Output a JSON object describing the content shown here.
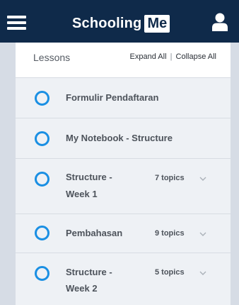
{
  "header": {
    "logo_text": "Schooling",
    "logo_box_text": "Me"
  },
  "panel": {
    "title": "Lessons",
    "expand_all": "Expand All",
    "separator": "|",
    "collapse_all": "Collapse All"
  },
  "lessons": [
    {
      "title_line1": "Formulir Pendaftaran",
      "title_line2": "",
      "topics": ""
    },
    {
      "title_line1": "My Notebook - Structure",
      "title_line2": "",
      "topics": ""
    },
    {
      "title_line1": "Structure -",
      "title_line2": "Week 1",
      "topics": "7 topics"
    },
    {
      "title_line1": "Pembahasan",
      "title_line2": "",
      "topics": "9 topics"
    },
    {
      "title_line1": "Structure -",
      "title_line2": "Week 2",
      "topics": "5 topics"
    }
  ],
  "colors": {
    "topbar": "#0f2a4a",
    "accent_circle": "#1a8fe3",
    "row_background": "#eef1f5"
  }
}
